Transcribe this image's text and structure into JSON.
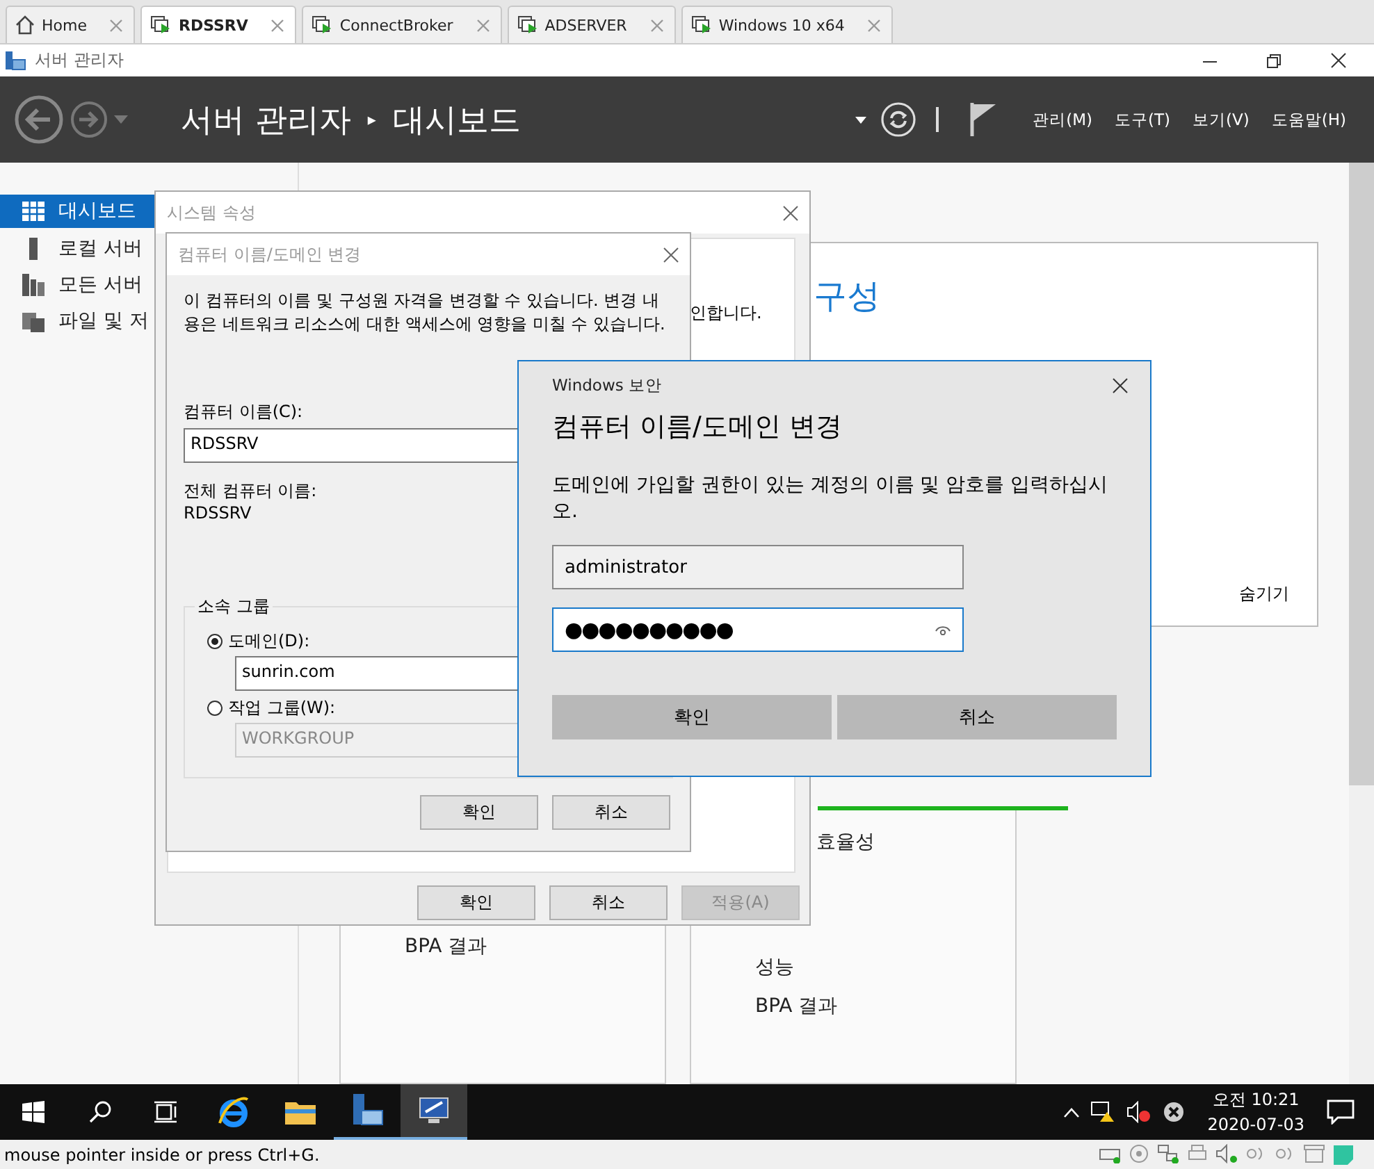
{
  "vm_tabs": [
    {
      "label": "Home",
      "kind": "home",
      "selected": false
    },
    {
      "label": "RDSSRV",
      "kind": "vm",
      "selected": true
    },
    {
      "label": "ConnectBroker",
      "kind": "vm",
      "selected": false
    },
    {
      "label": "ADSERVER",
      "kind": "vm",
      "selected": false
    },
    {
      "label": "Windows 10 x64",
      "kind": "vm",
      "selected": false
    }
  ],
  "app": {
    "title": "서버 관리자",
    "breadcrumb": [
      "서버 관리자",
      "대시보드"
    ],
    "breadcrumb_separator": "▸",
    "menu": [
      "관리(M)",
      "도구(T)",
      "보기(V)",
      "도움말(H)"
    ]
  },
  "sidebar": {
    "items": [
      {
        "label": "대시보드",
        "kind": "dashboard",
        "selected": true
      },
      {
        "label": "로컬 서버",
        "kind": "server",
        "selected": false
      },
      {
        "label": "모든 서버",
        "kind": "servers",
        "selected": false
      },
      {
        "label": "파일 및 저",
        "kind": "storage",
        "selected": false
      }
    ]
  },
  "dashboard": {
    "config_heading": "구성",
    "hide_link": "숨기기",
    "tiles": [
      {
        "items": [
          "BPA 결과"
        ]
      },
      {
        "items": [
          "효율성",
          "성능",
          "BPA 결과"
        ]
      }
    ]
  },
  "system_properties": {
    "title": "시스템 속성",
    "panel_text": "인합니다.",
    "buttons": [
      {
        "label": "확인",
        "disabled": false
      },
      {
        "label": "취소",
        "disabled": false
      },
      {
        "label": "적용(A)",
        "disabled": true
      }
    ]
  },
  "name_dialog": {
    "title": "컴퓨터 이름/도메인 변경",
    "description": "이 컴퓨터의 이름 및 구성원 자격을 변경할 수 있습니다. 변경 내용은 네트워크 리소스에 대한 액세스에 영향을 미칠 수 있습니다.",
    "computer_name_label": "컴퓨터 이름(C):",
    "computer_name": "RDSSRV",
    "full_name_label": "전체 컴퓨터 이름:",
    "full_name": "RDSSRV",
    "member_of": {
      "legend": "소속 그룹",
      "options": [
        {
          "label": "도메인(D):",
          "selected": true,
          "value": "sunrin.com"
        },
        {
          "label": "작업 그룹(W):",
          "selected": false,
          "value": "WORKGROUP"
        }
      ]
    },
    "buttons": [
      "확인",
      "취소"
    ]
  },
  "security_dialog": {
    "caption": "Windows 보안",
    "heading": "컴퓨터 이름/도메인 변경",
    "message": "도메인에 가입할 권한이 있는 계정의 이름 및 암호를 입력하십시오.",
    "username": "administrator",
    "password": "●●●●●●●●●●",
    "buttons": [
      "확인",
      "취소"
    ]
  },
  "taskbar": {
    "apps": [
      {
        "kind": "start",
        "running": false,
        "selected": false
      },
      {
        "kind": "search",
        "running": false,
        "selected": false
      },
      {
        "kind": "taskview",
        "running": false,
        "selected": false
      },
      {
        "kind": "browser",
        "running": false,
        "selected": false
      },
      {
        "kind": "folder",
        "running": false,
        "selected": false
      },
      {
        "kind": "servermanager",
        "running": true,
        "selected": false
      },
      {
        "kind": "remote",
        "running": true,
        "selected": true
      }
    ],
    "time": "오전 10:21",
    "date": "2020-07-03"
  },
  "status_bar": {
    "text": "mouse pointer inside or press Ctrl+G."
  }
}
